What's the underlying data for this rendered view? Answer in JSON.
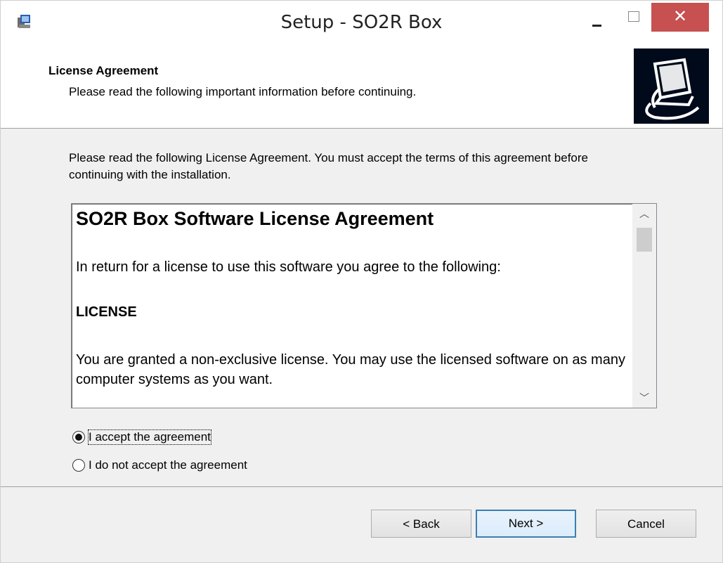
{
  "window": {
    "title": "Setup - SO2R Box",
    "close_label": "✕"
  },
  "header": {
    "title": "License Agreement",
    "subtitle": "Please read the following important information before continuing."
  },
  "intro": {
    "text": "Please read the following License Agreement. You must accept the terms of this agreement before continuing with the installation."
  },
  "license": {
    "heading": "SO2R Box Software License Agreement",
    "para1": "In return for a license to use this software you agree to the following:",
    "section": "LICENSE",
    "para2": "You are granted a non-exclusive license.  You may use the licensed software on as many computer systems as you want."
  },
  "options": {
    "accept_label": "I accept the agreement",
    "decline_label": "I do not accept the agreement",
    "selected": "accept"
  },
  "buttons": {
    "back": "< Back",
    "next": "Next >",
    "cancel": "Cancel"
  },
  "icons": {
    "app": "setup-icon",
    "header_image": "computer-install-icon",
    "scroll_up": "chevron-up-icon",
    "scroll_down": "chevron-down-icon"
  }
}
